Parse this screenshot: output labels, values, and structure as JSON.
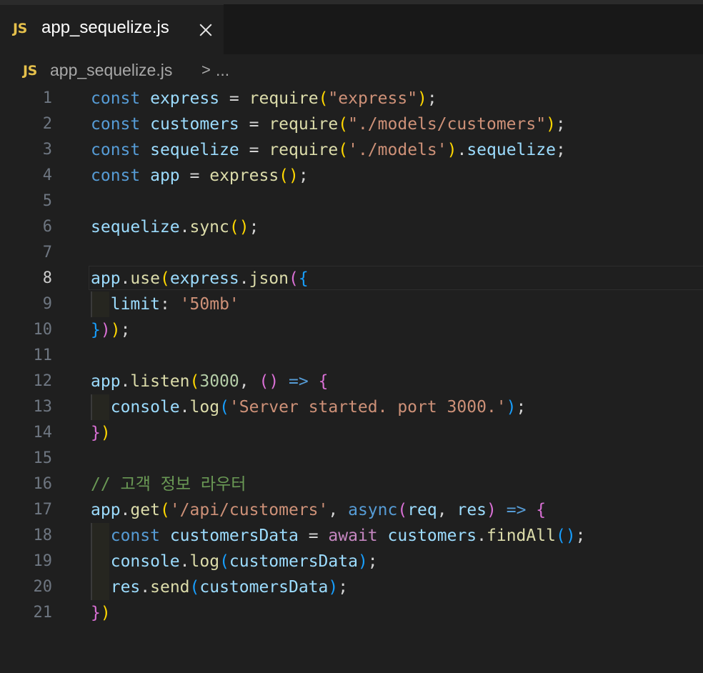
{
  "tab": {
    "badge": "JS",
    "filename": "app_sequelize.js"
  },
  "breadcrumb": {
    "badge": "JS",
    "file": "app_sequelize.js",
    "separator": ">",
    "more": "..."
  },
  "editor": {
    "active_line": 8,
    "lines": [
      {
        "n": "1",
        "text": "const express = require(\"express\");"
      },
      {
        "n": "2",
        "text": "const customers = require(\"./models/customers\");"
      },
      {
        "n": "3",
        "text": "const sequelize = require('./models').sequelize;"
      },
      {
        "n": "4",
        "text": "const app = express();"
      },
      {
        "n": "5",
        "text": ""
      },
      {
        "n": "6",
        "text": "sequelize.sync();"
      },
      {
        "n": "7",
        "text": ""
      },
      {
        "n": "8",
        "text": "app.use(express.json({"
      },
      {
        "n": "9",
        "text": "  limit: '50mb'"
      },
      {
        "n": "10",
        "text": "}));"
      },
      {
        "n": "11",
        "text": ""
      },
      {
        "n": "12",
        "text": "app.listen(3000, () => {"
      },
      {
        "n": "13",
        "text": "  console.log('Server started. port 3000.');"
      },
      {
        "n": "14",
        "text": "})"
      },
      {
        "n": "15",
        "text": ""
      },
      {
        "n": "16",
        "text": "// 고객 정보 라우터"
      },
      {
        "n": "17",
        "text": "app.get('/api/customers', async(req, res) => {"
      },
      {
        "n": "18",
        "text": "  const customersData = await customers.findAll();"
      },
      {
        "n": "19",
        "text": "  console.log(customersData);"
      },
      {
        "n": "20",
        "text": "  res.send(customersData);"
      },
      {
        "n": "21",
        "text": "})"
      }
    ]
  }
}
